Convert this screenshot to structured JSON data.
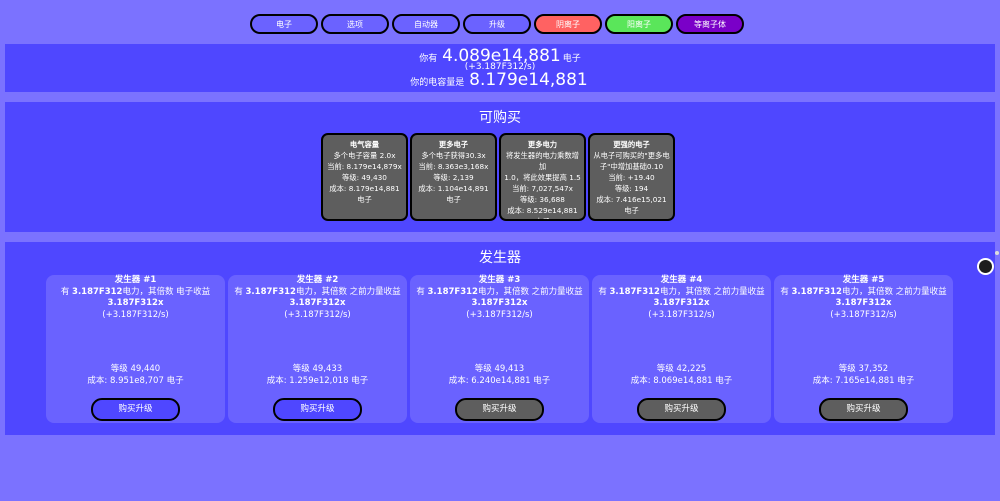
{
  "tabs": [
    {
      "label": "电子",
      "color": "#6b62ff"
    },
    {
      "label": "选项",
      "color": "#6b62ff"
    },
    {
      "label": "自动器",
      "color": "#6b62ff"
    },
    {
      "label": "升级",
      "color": "#6b62ff"
    },
    {
      "label": "阴离子",
      "color": "#ff6262"
    },
    {
      "label": "阳离子",
      "color": "#5ae65a"
    },
    {
      "label": "等离子体",
      "color": "#7a00c8"
    }
  ],
  "resources": {
    "have_prefix": "你有",
    "electrons": "4.089e14,881",
    "electrons_suffix": "电子",
    "rate": "(+3.187F312/s)",
    "capacity_prefix": "你的电容量是",
    "capacity": "8.179e14,881"
  },
  "buyables": {
    "title": "可购买",
    "items": [
      {
        "title": "电气容量",
        "lines": [
          "多个电子容量 2.0x",
          "当前: 8.179e14,879x",
          "等级: 49,430",
          "成本: 8.179e14,881",
          "电子"
        ]
      },
      {
        "title": "更多电子",
        "lines": [
          "多个电子获得30.3x",
          "当前: 8.363e3,168x",
          "等级: 2,139",
          "成本: 1.104e14,891",
          "电子"
        ]
      },
      {
        "title": "更多电力",
        "lines": [
          "将发生器的电力乘数增加",
          "1.0，将此效果提高 1.5",
          "当前: 7,027,547x",
          "等级: 36,688",
          "成本: 8.529e14,881",
          "电子"
        ]
      },
      {
        "title": "更强的电子",
        "lines": [
          "从电子可购买的\"更多电",
          "子\"中增加基础0.10",
          "当前: +19.40",
          "等级: 194",
          "成本: 7.416e15,021",
          "电子"
        ]
      }
    ]
  },
  "generators": {
    "title": "发生器",
    "items": [
      {
        "title": "发生器 #1",
        "desc_pre": "有 ",
        "power": "3.187F312",
        "desc_post": "电力，其倍数 电子收益",
        "mult": "3.187F312x",
        "rate": "(+3.187F312/s)",
        "level": "等级 49,440",
        "cost": "成本: 8.951e8,707 电子",
        "button": "购买升级",
        "affordable": true
      },
      {
        "title": "发生器 #2",
        "desc_pre": "有 ",
        "power": "3.187F312",
        "desc_post": "电力，其倍数 之前力量收益",
        "mult": "3.187F312x",
        "rate": "(+3.187F312/s)",
        "level": "等级 49,433",
        "cost": "成本: 1.259e12,018 电子",
        "button": "购买升级",
        "affordable": true
      },
      {
        "title": "发生器 #3",
        "desc_pre": "有 ",
        "power": "3.187F312",
        "desc_post": "电力，其倍数 之前力量收益",
        "mult": "3.187F312x",
        "rate": "(+3.187F312/s)",
        "level": "等级 49,413",
        "cost": "成本: 6.240e14,881 电子",
        "button": "购买升级",
        "affordable": false
      },
      {
        "title": "发生器 #4",
        "desc_pre": "有 ",
        "power": "3.187F312",
        "desc_post": "电力，其倍数 之前力量收益",
        "mult": "3.187F312x",
        "rate": "(+3.187F312/s)",
        "level": "等级 42,225",
        "cost": "成本: 8.069e14,881 电子",
        "button": "购买升级",
        "affordable": false
      },
      {
        "title": "发生器 #5",
        "desc_pre": "有 ",
        "power": "3.187F312",
        "desc_post": "电力，其倍数 之前力量收益",
        "mult": "3.187F312x",
        "rate": "(+3.187F312/s)",
        "level": "等级 37,352",
        "cost": "成本: 7.165e14,881 电子",
        "button": "购买升级",
        "affordable": false
      }
    ]
  },
  "colors": {
    "background": "#7b72ff",
    "panel": "#4f47ff",
    "card": "#6a62ff",
    "buyable_card": "#5e5e5e"
  },
  "icons": {
    "mascot": "cat-avatar-icon"
  }
}
